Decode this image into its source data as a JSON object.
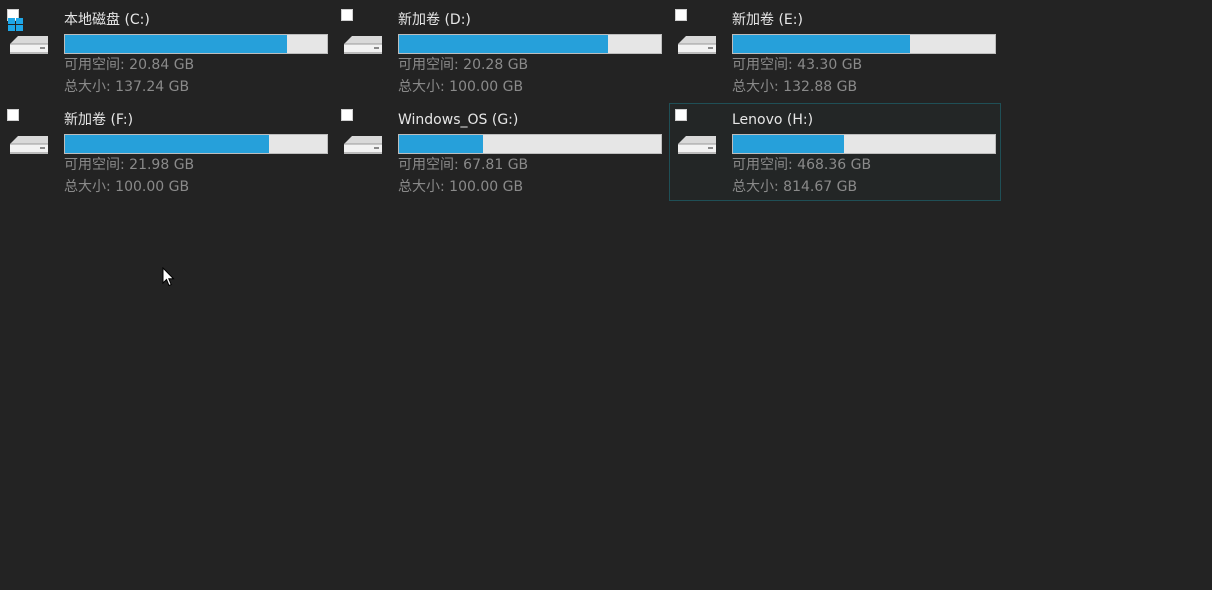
{
  "colors": {
    "background": "#232323",
    "bar_fill": "#26a0da",
    "bar_track": "#e6e6e6",
    "text_primary": "#e6e6e6",
    "text_secondary": "#8a8a8a",
    "selection_border": "#1f4f56"
  },
  "labels": {
    "free": "可用空间:",
    "total": "总大小:"
  },
  "drives": [
    {
      "name": "本地磁盘 (C:)",
      "free": "20.84 GB",
      "total": "137.24 GB",
      "used_fraction": 0.848,
      "system_drive": true,
      "selected": false,
      "icon": "hard-drive-icon"
    },
    {
      "name": "新加卷 (D:)",
      "free": "20.28 GB",
      "total": "100.00 GB",
      "used_fraction": 0.797,
      "system_drive": false,
      "selected": false,
      "icon": "hard-drive-icon"
    },
    {
      "name": "新加卷 (E:)",
      "free": "43.30 GB",
      "total": "132.88 GB",
      "used_fraction": 0.674,
      "system_drive": false,
      "selected": false,
      "icon": "hard-drive-icon"
    },
    {
      "name": "新加卷 (F:)",
      "free": "21.98 GB",
      "total": "100.00 GB",
      "used_fraction": 0.78,
      "system_drive": false,
      "selected": false,
      "icon": "hard-drive-icon"
    },
    {
      "name": "Windows_OS (G:)",
      "free": "67.81 GB",
      "total": "100.00 GB",
      "used_fraction": 0.322,
      "system_drive": false,
      "selected": false,
      "icon": "hard-drive-icon"
    },
    {
      "name": "Lenovo (H:)",
      "free": "468.36 GB",
      "total": "814.67 GB",
      "used_fraction": 0.425,
      "system_drive": false,
      "selected": true,
      "icon": "hard-drive-icon"
    }
  ]
}
